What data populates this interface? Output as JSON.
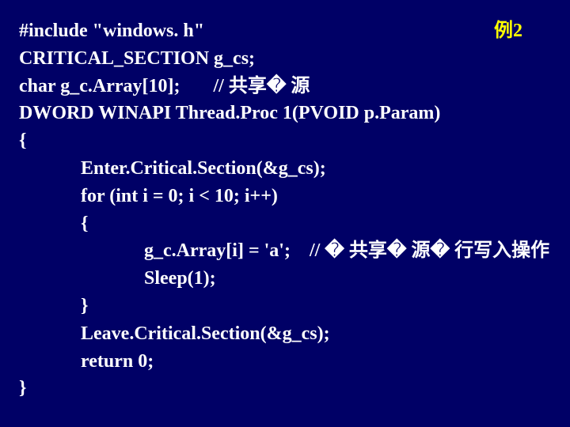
{
  "label": "例2",
  "code": {
    "l1": "#include \"windows. h\"",
    "l2": "CRITICAL_SECTION g_cs;",
    "l3a": "char g_c.Array[10];       ",
    "l3b": "// 共享� 源",
    "l4": "DWORD WINAPI Thread.Proc 1(PVOID p.Param)",
    "l5": "{",
    "l6": "Enter.Critical.Section(&g_cs);",
    "l7": "for (int i = 0; i < 10; i++)",
    "l8": "{",
    "l9a": "g_c.Array[i] = 'a';    ",
    "l9b": "// � 共享� 源� 行写入操作",
    "l10": "Sleep(1);",
    "l11": "}",
    "l12": "Leave.Critical.Section(&g_cs);",
    "l13": "return 0;",
    "l14": "}"
  }
}
